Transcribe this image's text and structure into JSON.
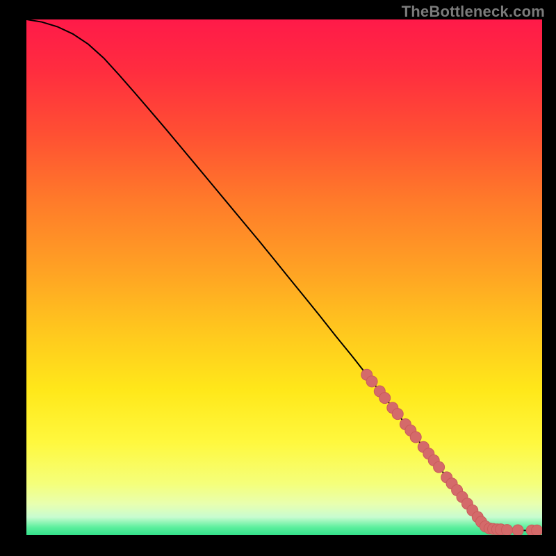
{
  "attribution": "TheBottleneck.com",
  "colors": {
    "line": "#000000",
    "marker": "#d46a6a",
    "marker_stroke": "#c95b5b"
  },
  "chart_data": {
    "type": "line",
    "title": "",
    "xlabel": "",
    "ylabel": "",
    "xlim": [
      0,
      100
    ],
    "ylim": [
      0,
      100
    ],
    "grid": false,
    "legend": false,
    "series": [
      {
        "name": "curve",
        "x": [
          0,
          3,
          6,
          9,
          12,
          15,
          18,
          21,
          24,
          27,
          30,
          33,
          36,
          39,
          42,
          45,
          48,
          51,
          54,
          57,
          60,
          63,
          66,
          69,
          72,
          75,
          78,
          81,
          84,
          87,
          89,
          91,
          93,
          95,
          100
        ],
        "y": [
          100,
          99.5,
          98.6,
          97.2,
          95.2,
          92.5,
          89.2,
          85.8,
          82.3,
          78.8,
          75.2,
          71.6,
          68.0,
          64.4,
          60.8,
          57.2,
          53.5,
          49.8,
          46.1,
          42.4,
          38.6,
          34.9,
          31.1,
          27.3,
          23.5,
          19.6,
          15.8,
          11.9,
          8.0,
          4.1,
          1.7,
          1.2,
          1.0,
          0.9,
          0.9
        ]
      }
    ],
    "markers": [
      {
        "x": 66,
        "y": 31.1
      },
      {
        "x": 67,
        "y": 29.8
      },
      {
        "x": 68.5,
        "y": 27.9
      },
      {
        "x": 69.5,
        "y": 26.6
      },
      {
        "x": 71,
        "y": 24.7
      },
      {
        "x": 72,
        "y": 23.5
      },
      {
        "x": 73.5,
        "y": 21.5
      },
      {
        "x": 74.5,
        "y": 20.3
      },
      {
        "x": 75.5,
        "y": 19.0
      },
      {
        "x": 77,
        "y": 17.1
      },
      {
        "x": 78,
        "y": 15.8
      },
      {
        "x": 79,
        "y": 14.5
      },
      {
        "x": 80,
        "y": 13.2
      },
      {
        "x": 81.5,
        "y": 11.2
      },
      {
        "x": 82.5,
        "y": 10.0
      },
      {
        "x": 83.5,
        "y": 8.7
      },
      {
        "x": 84.5,
        "y": 7.4
      },
      {
        "x": 85.5,
        "y": 6.1
      },
      {
        "x": 86.5,
        "y": 4.8
      },
      {
        "x": 87.5,
        "y": 3.5
      },
      {
        "x": 88.2,
        "y": 2.6
      },
      {
        "x": 89,
        "y": 1.7
      },
      {
        "x": 89.8,
        "y": 1.3
      },
      {
        "x": 90.5,
        "y": 1.2
      },
      {
        "x": 91.3,
        "y": 1.1
      },
      {
        "x": 92,
        "y": 1.1
      },
      {
        "x": 93.2,
        "y": 1.0
      },
      {
        "x": 95.3,
        "y": 0.95
      },
      {
        "x": 98,
        "y": 0.9
      },
      {
        "x": 99,
        "y": 0.9
      }
    ],
    "gradient_stops": [
      {
        "offset": 0.0,
        "color": "#ff1a49"
      },
      {
        "offset": 0.1,
        "color": "#ff2d3f"
      },
      {
        "offset": 0.22,
        "color": "#ff4f33"
      },
      {
        "offset": 0.35,
        "color": "#ff7a2a"
      },
      {
        "offset": 0.48,
        "color": "#ffa024"
      },
      {
        "offset": 0.6,
        "color": "#ffc61e"
      },
      {
        "offset": 0.72,
        "color": "#ffe81a"
      },
      {
        "offset": 0.82,
        "color": "#fff83e"
      },
      {
        "offset": 0.9,
        "color": "#f5ff7a"
      },
      {
        "offset": 0.94,
        "color": "#e8ffb0"
      },
      {
        "offset": 0.965,
        "color": "#c8fcd0"
      },
      {
        "offset": 0.985,
        "color": "#5bef9d"
      },
      {
        "offset": 1.0,
        "color": "#33e08a"
      }
    ]
  }
}
